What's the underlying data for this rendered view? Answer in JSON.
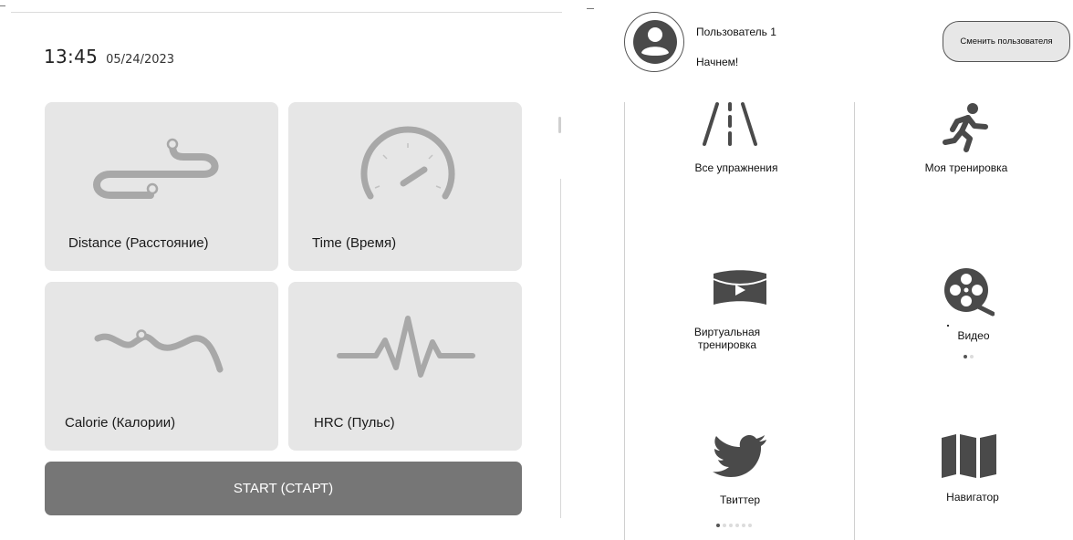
{
  "dashboard": {
    "clock": {
      "time": "13:45",
      "date": "05/24/2023"
    },
    "tiles": [
      {
        "label": "Distance (Расстояние)",
        "icon": "route-icon"
      },
      {
        "label": "Time (Время)",
        "icon": "speedometer-icon"
      },
      {
        "label": "Calorie (Калории)",
        "icon": "wavy-path-icon"
      },
      {
        "label": "HRC (Пульс)",
        "icon": "heartbeat-icon"
      }
    ],
    "start_label": "START (СТАРТ)",
    "colors": {
      "tile_bg": "#e6e6e6",
      "icon_gray": "#a8a8a8",
      "start_bg": "#767676"
    }
  },
  "launcher": {
    "user": {
      "name": "Пользователь 1",
      "greeting": "Начнем!",
      "avatar_icon": "user-avatar-icon"
    },
    "switch_user_label": "Сменить пользователя",
    "apps": [
      {
        "label": "Все упражнения",
        "icon": "road-icon"
      },
      {
        "label": "Моя тренировка",
        "icon": "running-man-icon"
      },
      {
        "label": "Виртуальная тренировка",
        "icon": "panorama-video-icon"
      },
      {
        "label": "Видео",
        "icon": "film-reel-icon"
      },
      {
        "label": "Твиттер",
        "icon": "twitter-bird-icon"
      },
      {
        "label": "Навигатор",
        "icon": "map-icon"
      }
    ],
    "video_pager": {
      "count": 2,
      "active": 1
    },
    "page_indicator": {
      "count": 6,
      "active": 1
    },
    "colors": {
      "icon_dark": "#4a4a4a",
      "button_bg": "#e7e7e7"
    }
  }
}
